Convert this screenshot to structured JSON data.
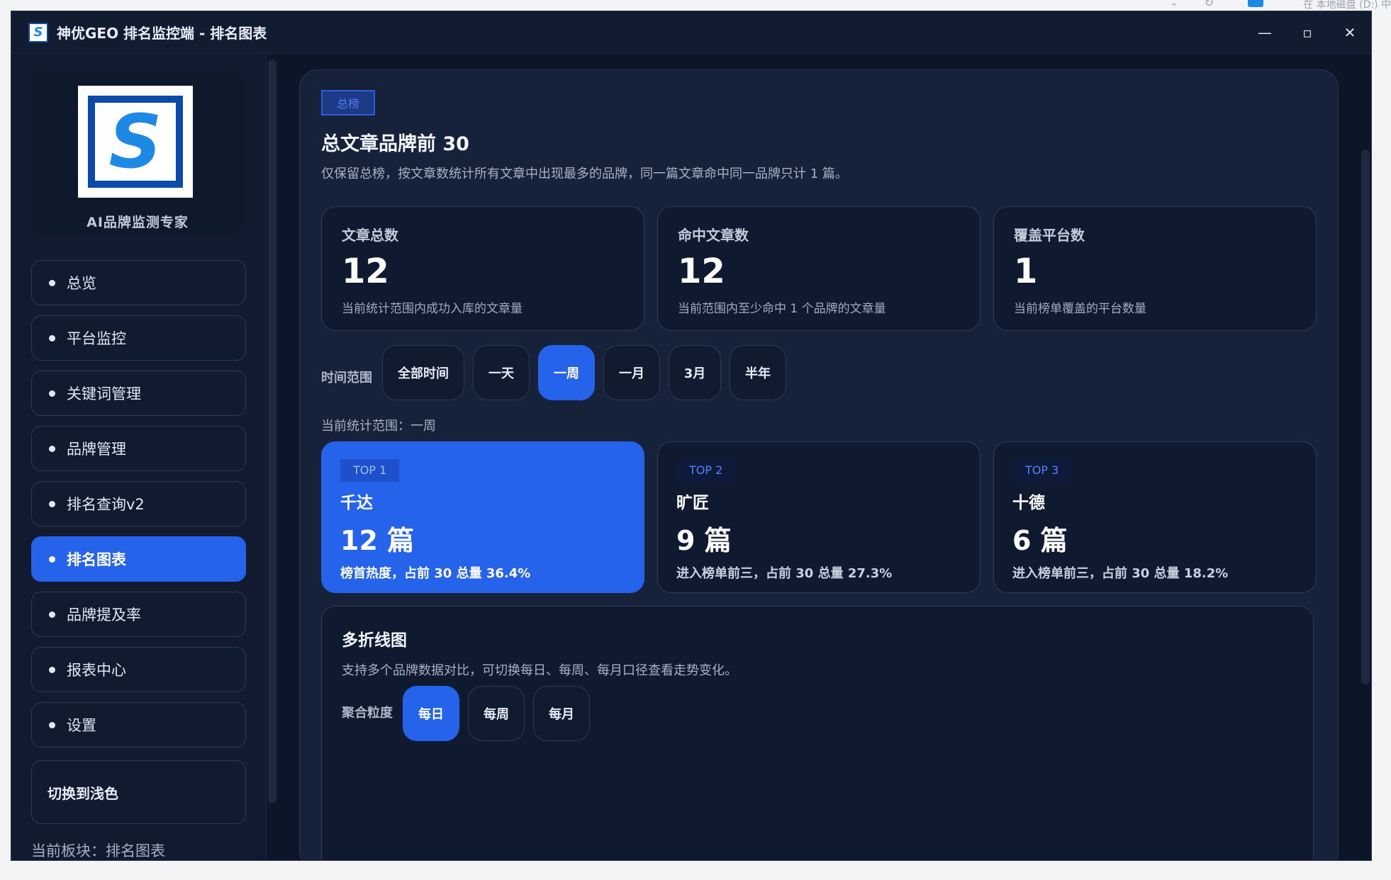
{
  "window": {
    "title": "神优GEO 排名监控端 - 排名图表",
    "minimize": "—",
    "maximize": "▫",
    "close": "✕"
  },
  "desktop": {
    "address_hint": "在 本地磁盘 (D:) 中"
  },
  "sidebar": {
    "logo_caption": "AI品牌监测专家",
    "items": [
      {
        "label": "总览"
      },
      {
        "label": "平台监控"
      },
      {
        "label": "关键词管理"
      },
      {
        "label": "品牌管理"
      },
      {
        "label": "排名查询v2"
      },
      {
        "label": "排名图表"
      },
      {
        "label": "品牌提及率"
      },
      {
        "label": "报表中心"
      },
      {
        "label": "设置"
      }
    ],
    "active_item": "排名图表",
    "theme_toggle": "切换到浅色",
    "current_module": "当前板块：排名图表"
  },
  "main": {
    "tag": "总榜",
    "title": "总文章品牌前 30",
    "description": "仅保留总榜，按文章数统计所有文章中出现最多的品牌，同一篇文章命中同一品牌只计 1 篇。",
    "stats": [
      {
        "label": "文章总数",
        "value": "12",
        "note": "当前统计范围内成功入库的文章量"
      },
      {
        "label": "命中文章数",
        "value": "12",
        "note": "当前范围内至少命中 1 个品牌的文章量"
      },
      {
        "label": "覆盖平台数",
        "value": "1",
        "note": "当前榜单覆盖的平台数量"
      }
    ],
    "time_range": {
      "label": "时间范围",
      "options": [
        "全部时间",
        "一天",
        "一周",
        "一月",
        "3月",
        "半年"
      ],
      "selected": "一周",
      "current_text": "当前统计范围：一周"
    },
    "top": [
      {
        "badge": "TOP 1",
        "brand": "千达",
        "count": "12 篇",
        "note": "榜首热度，占前 30 总量 36.4%"
      },
      {
        "badge": "TOP 2",
        "brand": "旷匠",
        "count": "9 篇",
        "note": "进入榜单前三，占前 30 总量 27.3%"
      },
      {
        "badge": "TOP 3",
        "brand": "十德",
        "count": "6 篇",
        "note": "进入榜单前三，占前 30 总量 18.2%"
      }
    ],
    "chart": {
      "title": "多折线图",
      "description": "支持多个品牌数据对比，可切换每日、每周、每月口径查看走势变化。",
      "agg_label": "聚合粒度",
      "agg_options": [
        "每日",
        "每周",
        "每月"
      ],
      "agg_selected": "每日"
    }
  },
  "colors": {
    "accent": "#2563eb",
    "window_bg": "#0d1629",
    "panel_bg": "#16213a",
    "card_bg": "#0f1930"
  }
}
